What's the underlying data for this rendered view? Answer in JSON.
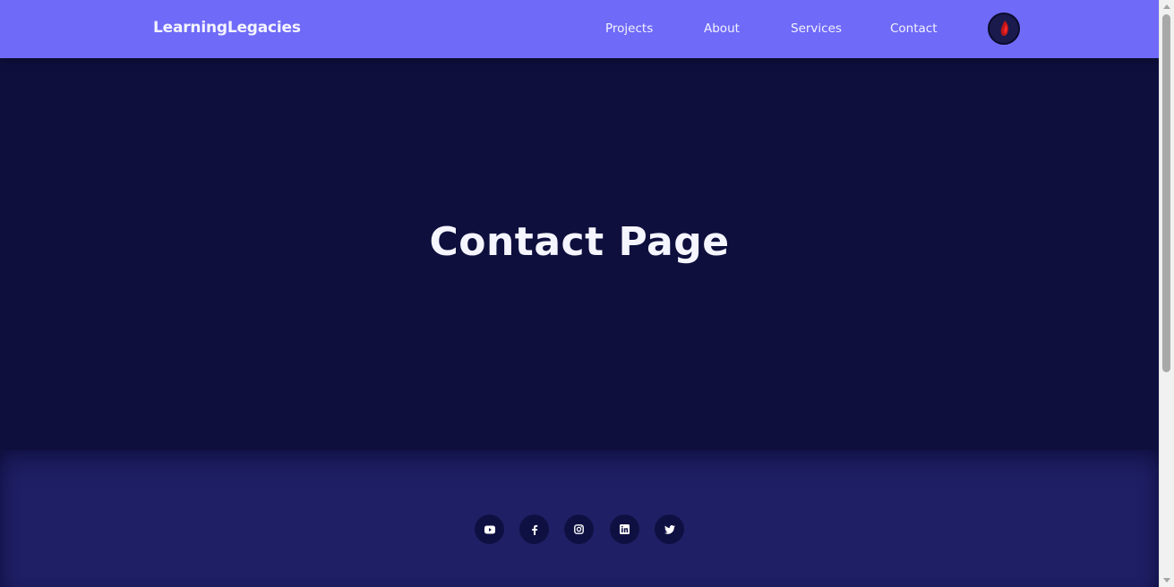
{
  "navbar": {
    "brand": "LearningLegacies",
    "links": [
      {
        "label": "Projects"
      },
      {
        "label": "About"
      },
      {
        "label": "Services"
      },
      {
        "label": "Contact"
      }
    ],
    "avatar_icon": "user-avatar-icon"
  },
  "hero": {
    "title": "Contact Page"
  },
  "footer": {
    "social": [
      {
        "icon": "youtube-icon"
      },
      {
        "icon": "facebook-icon"
      },
      {
        "icon": "instagram-icon"
      },
      {
        "icon": "linkedin-icon"
      },
      {
        "icon": "twitter-icon"
      }
    ]
  },
  "colors": {
    "navbar_bg": "#6f6af8",
    "hero_bg": "#0e0f3d",
    "footer_bg": "#1f1f65",
    "social_btn_bg": "#0f1042",
    "text": "#f5f5ff"
  }
}
